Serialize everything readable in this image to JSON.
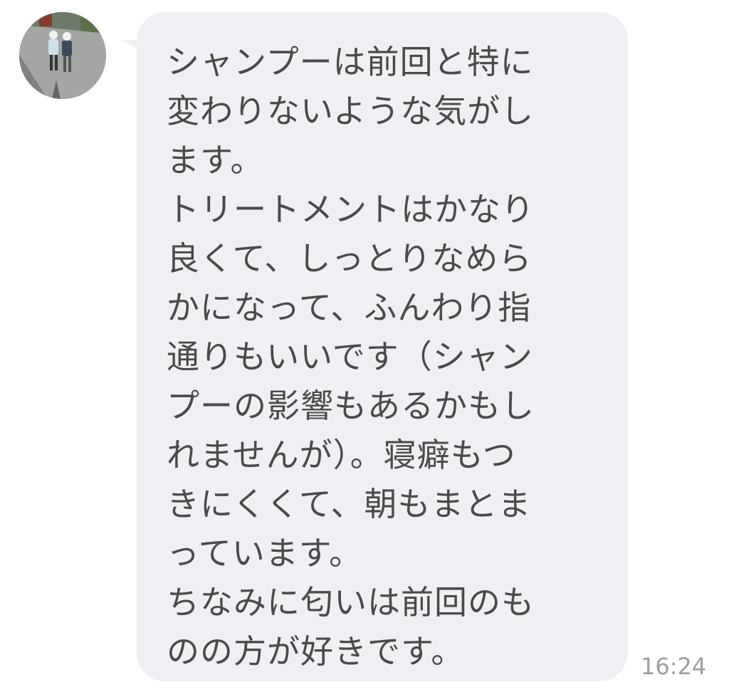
{
  "message": {
    "text": "シャンプーは前回と特に\n変わりないような気がし\nます。\nトリートメントはかなり\n良くて、しっとりなめら\nかになって、ふんわり指\n通りもいいです（シャン\nプーの影響もあるかもし\nれませんが）。寝癖もつ\nきにくくて、朝もまとま\nっています。\nちなみに匂いは前回のも\nのの方が好きです。",
    "time": "16:24"
  },
  "colors": {
    "bubble": "#eff0f3",
    "text": "#4a4a4a",
    "timestamp": "#9b9ea3"
  }
}
